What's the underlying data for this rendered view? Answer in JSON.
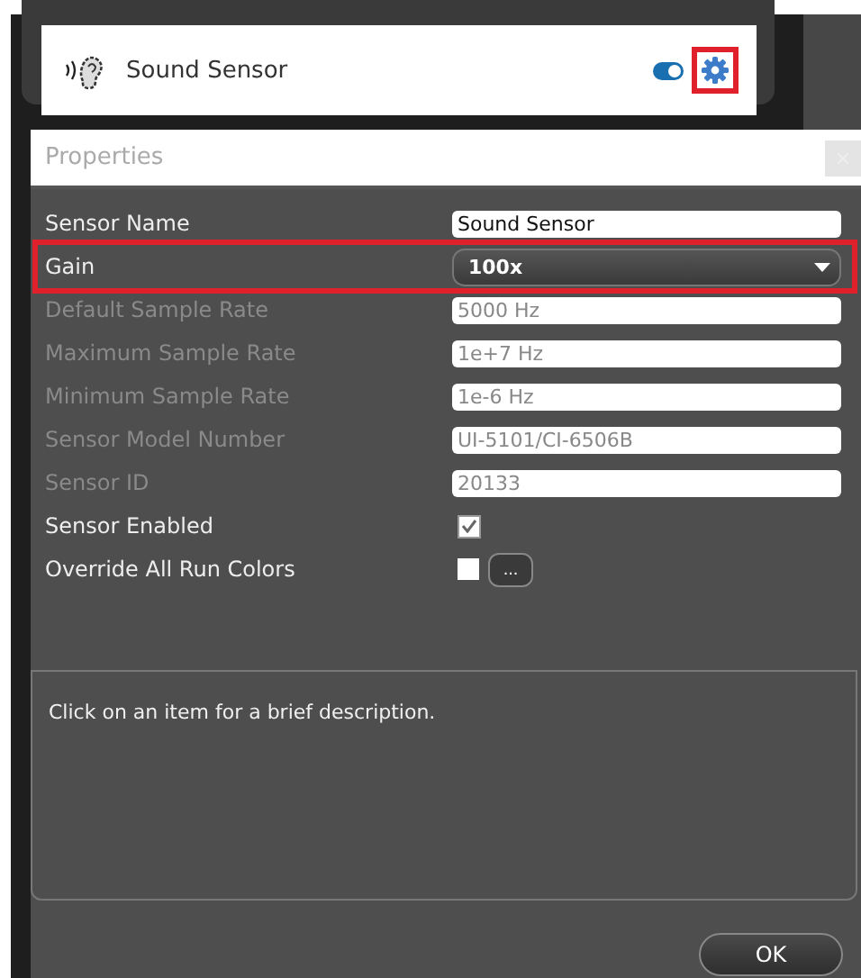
{
  "sensor_card": {
    "name": "Sound Sensor",
    "toggle_on": true,
    "settings_highlighted": true
  },
  "dialog": {
    "title": "Properties",
    "rows": [
      {
        "kind": "text",
        "label": "Sensor Name",
        "value": "Sound Sensor",
        "disabled": false,
        "highlighted": false
      },
      {
        "kind": "dropdown",
        "label": "Gain",
        "value": "100x",
        "disabled": false,
        "highlighted": true
      },
      {
        "kind": "text",
        "label": "Default Sample Rate",
        "value": "5000 Hz",
        "disabled": true,
        "highlighted": false
      },
      {
        "kind": "text",
        "label": "Maximum Sample Rate",
        "value": "1e+7 Hz",
        "disabled": true,
        "highlighted": false
      },
      {
        "kind": "text",
        "label": "Minimum Sample Rate",
        "value": "1e-6 Hz",
        "disabled": true,
        "highlighted": false
      },
      {
        "kind": "text",
        "label": "Sensor Model Number",
        "value": "UI-5101/CI-6506B",
        "disabled": true,
        "highlighted": false
      },
      {
        "kind": "text",
        "label": "Sensor ID",
        "value": "20133",
        "disabled": true,
        "highlighted": false
      },
      {
        "kind": "checkbox",
        "label": "Sensor Enabled",
        "checked": true,
        "disabled": false,
        "highlighted": false
      },
      {
        "kind": "color",
        "label": "Override All Run Colors",
        "color": "#ffffff",
        "button": "...",
        "disabled": false,
        "highlighted": false
      }
    ],
    "description": "Click on an item for a brief description.",
    "ok_button": "OK"
  }
}
